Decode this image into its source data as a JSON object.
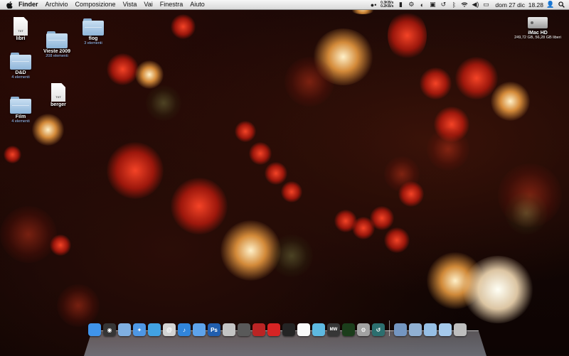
{
  "menubar": {
    "apple_icon": "apple-icon",
    "items": [
      "Finder",
      "Archivio",
      "Composizione",
      "Vista",
      "Vai",
      "Finestra",
      "Aiuto"
    ],
    "net_down": "0.3KB/s",
    "net_up": "0.2KB/s",
    "datetime": "dom 27 dic  18.28"
  },
  "desktop_icons": [
    {
      "name": "libri",
      "sub": "",
      "kind": "txt"
    },
    {
      "name": "Vieste 2009",
      "sub": "208 elementi",
      "kind": "folder"
    },
    {
      "name": "flog",
      "sub": "3 elementi",
      "kind": "folder"
    },
    {
      "name": "D&D",
      "sub": "4 elementi",
      "kind": "folder"
    },
    {
      "name": "berger",
      "sub": "",
      "kind": "txt"
    },
    {
      "name": "Film",
      "sub": "4 elementi",
      "kind": "folder"
    },
    {
      "name": "iMac HD",
      "sub": "249,72 GB, 56,28 GB liberi",
      "kind": "drive"
    }
  ],
  "file_ext": "TXT",
  "dock": {
    "apps": [
      {
        "icon": "finder-icon",
        "color": "#3d8de0",
        "glyph": ""
      },
      {
        "icon": "dashboard-icon",
        "color": "#333333",
        "glyph": "◉"
      },
      {
        "icon": "mail-stamp-icon",
        "color": "#7aa7d6",
        "glyph": ""
      },
      {
        "icon": "safari-icon",
        "color": "#4a90d9",
        "glyph": "✦"
      },
      {
        "icon": "ichat-icon",
        "color": "#3f9ad8",
        "glyph": ""
      },
      {
        "icon": "address-book-icon",
        "color": "#c9c9c9",
        "glyph": "@"
      },
      {
        "icon": "itunes-icon",
        "color": "#2f7fd1",
        "glyph": "♪"
      },
      {
        "icon": "imovie-icon",
        "color": "#5a9be0",
        "glyph": ""
      },
      {
        "icon": "photoshop-icon",
        "color": "#1f5aa6",
        "glyph": "Ps"
      },
      {
        "icon": "iphoto-icon",
        "color": "#bbbbbb",
        "glyph": ""
      },
      {
        "icon": "camera-icon",
        "color": "#555555",
        "glyph": ""
      },
      {
        "icon": "preview-icon",
        "color": "#b22222",
        "glyph": ""
      },
      {
        "icon": "red-app-icon",
        "color": "#cc2222",
        "glyph": ""
      },
      {
        "icon": "tophat-icon",
        "color": "#222222",
        "glyph": ""
      },
      {
        "icon": "calendar-icon",
        "color": "#eeeeee",
        "glyph": ""
      },
      {
        "icon": "photo-app-icon",
        "color": "#5ab0d6",
        "glyph": ""
      },
      {
        "icon": "game-mw-icon",
        "color": "#333333",
        "glyph": "MW"
      },
      {
        "icon": "activity-monitor-icon",
        "color": "#1a3a1a",
        "glyph": ""
      },
      {
        "icon": "system-preferences-icon",
        "color": "#9a9a9a",
        "glyph": "⚙"
      },
      {
        "icon": "time-machine-icon",
        "color": "#2a6a6a",
        "glyph": "↺"
      }
    ],
    "right": [
      {
        "icon": "applications-folder-icon",
        "color": "#6e8fb8",
        "glyph": ""
      },
      {
        "icon": "documents-stack-icon",
        "color": "#8aa8c8",
        "glyph": ""
      },
      {
        "icon": "downloads-folder-icon",
        "color": "#8fb6da",
        "glyph": ""
      },
      {
        "icon": "folder-stack-icon",
        "color": "#9dbfe0",
        "glyph": ""
      },
      {
        "icon": "trash-icon",
        "color": "#b5b5b5",
        "glyph": ""
      }
    ]
  }
}
